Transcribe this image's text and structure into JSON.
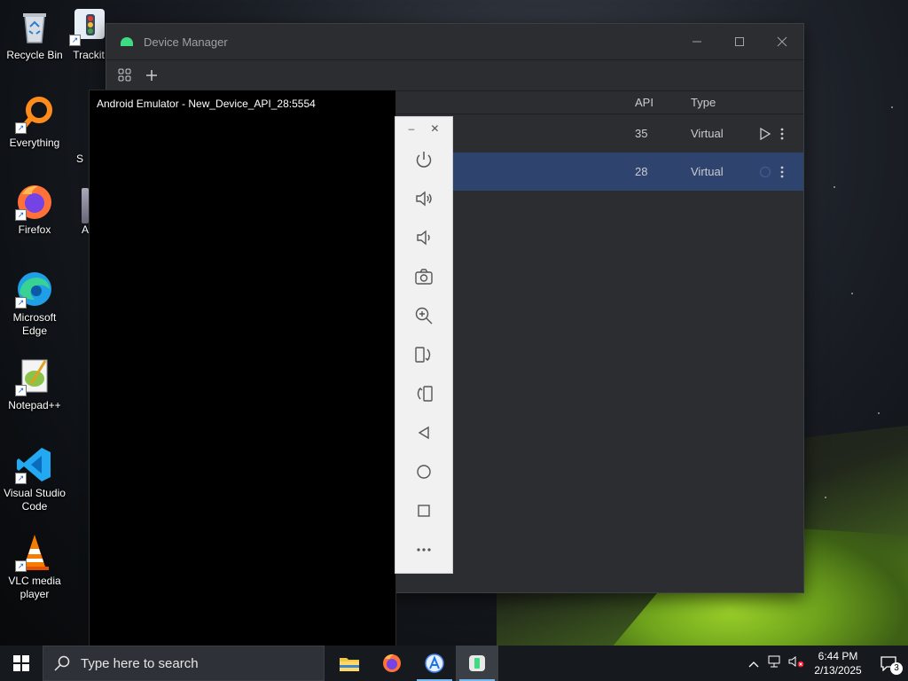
{
  "desktop": {
    "icons": [
      {
        "label": "Recycle Bin",
        "icon": "recycle-bin-icon"
      },
      {
        "label": "Trackit",
        "icon": "trackit-icon"
      },
      {
        "label": "Everything",
        "icon": "everything-icon"
      },
      {
        "label": "Firefox",
        "icon": "firefox-icon"
      },
      {
        "label": "Microsoft Edge",
        "icon": "edge-icon"
      },
      {
        "label": "Notepad++",
        "icon": "notepadpp-icon"
      },
      {
        "label": "Visual Studio Code",
        "icon": "vscode-icon"
      },
      {
        "label": "VLC media player",
        "icon": "vlc-icon"
      }
    ],
    "partial_labels": [
      "S",
      "A"
    ]
  },
  "device_manager": {
    "title": "Device Manager",
    "toolbar": {
      "device_groups_icon": "device-groups-icon",
      "add_icon": "add-icon"
    },
    "columns": {
      "api": "API",
      "type": "Type"
    },
    "rows": [
      {
        "api": "35",
        "type": "Virtual",
        "selected": false
      },
      {
        "api": "28",
        "type": "Virtual",
        "selected": true
      }
    ]
  },
  "emulator": {
    "title": "Android Emulator - New_Device_API_28:5554",
    "tools": [
      "power-icon",
      "volume-up-icon",
      "volume-down-icon",
      "camera-icon",
      "zoom-icon",
      "rotate-left-icon",
      "rotate-right-icon",
      "back-icon",
      "home-icon",
      "overview-icon",
      "more-icon"
    ]
  },
  "taskbar": {
    "search_placeholder": "Type here to search",
    "apps": [
      "file-explorer-icon",
      "firefox-icon",
      "android-studio-icon",
      "emulator-icon"
    ],
    "time": "6:44 PM",
    "date": "2/13/2025",
    "notification_count": "3"
  },
  "colors": {
    "accent": "#2e436e",
    "android_green": "#3ddc84",
    "taskbar": "#161a1f"
  }
}
